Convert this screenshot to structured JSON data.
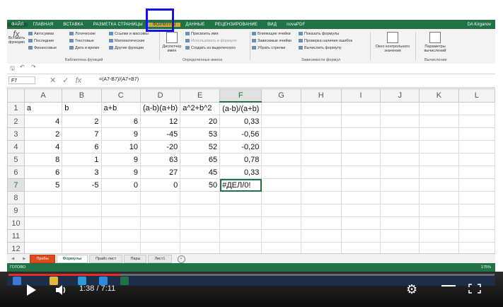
{
  "ribbon_tabs": [
    "ФАЙЛ",
    "ГЛАВНАЯ",
    "ВСТАВКА",
    "РАЗМЕТКА СТРАНИЦЫ",
    "ФОРМУЛЫ",
    "ДАННЫЕ",
    "РЕЦЕНЗИРОВАНИЕ",
    "ВИД",
    "novaPDF"
  ],
  "active_tab": "ФОРМУЛЫ",
  "user": "DA Kirganov",
  "ribbon": {
    "insert_function": "Вставить функцию",
    "autosum": "Автосумма",
    "recent": "Последние",
    "financial": "Финансовые",
    "logical": "Логические",
    "text": "Текстовые",
    "datetime": "Дата и время",
    "lookup": "Ссылки и массивы",
    "math": "Математические",
    "more": "Другие функции",
    "library_label": "Библиотека функций",
    "name_manager": "Диспетчер имен",
    "assign_name": "Присвоить имя",
    "use_in_formula": "Использовать в формуле",
    "create_from_sel": "Создать из выделенного",
    "names_label": "Определенные имена",
    "trace_prec": "Влияющие ячейки",
    "trace_dep": "Зависимые ячейки",
    "remove_arrows": "Убрать стрелки",
    "show_formulas": "Показать формулы",
    "error_check": "Проверка наличия ошибок",
    "evaluate": "Вычислить формулу",
    "audit_label": "Зависимости формул",
    "watch": "Окно контрольного значения",
    "calc_options": "Параметры вычислений",
    "calc_label": "Вычисление"
  },
  "name_box": "F7",
  "formula": "=(A7-B7)/(A7+B7)",
  "columns": [
    "A",
    "B",
    "C",
    "D",
    "E",
    "F",
    "G",
    "H",
    "I",
    "J",
    "K",
    "L"
  ],
  "rows": [
    [
      "a",
      "b",
      "a+b",
      "(a-b)(a+b)",
      "a^2+b^2",
      "(a-b)/(a+b)"
    ],
    [
      "4",
      "2",
      "6",
      "12",
      "20",
      "0,33"
    ],
    [
      "2",
      "7",
      "9",
      "-45",
      "53",
      "-0,56"
    ],
    [
      "4",
      "6",
      "10",
      "-20",
      "52",
      "-0,20"
    ],
    [
      "8",
      "1",
      "9",
      "63",
      "65",
      "0,78"
    ],
    [
      "6",
      "3",
      "9",
      "27",
      "45",
      "0,33"
    ],
    [
      "5",
      "-5",
      "0",
      "0",
      "50",
      "#ДЕЛ/0!"
    ],
    [
      "",
      "",
      "",
      "",
      "",
      ""
    ],
    [
      "",
      "",
      "",
      "",
      "",
      ""
    ],
    [
      "",
      "",
      "",
      "",
      "",
      ""
    ],
    [
      "",
      "",
      "",
      "",
      "",
      ""
    ],
    [
      "",
      "",
      "",
      "",
      "",
      ""
    ]
  ],
  "sheet_tabs": [
    "Пробы",
    "Формулы",
    "Прайс-лист",
    "Пары",
    "Лист1"
  ],
  "active_sheet": "Формулы",
  "status": "ГОТОВО",
  "zoom": "175%",
  "video": {
    "current_time": "1:38",
    "duration": "7:11",
    "progress": 0.228
  }
}
